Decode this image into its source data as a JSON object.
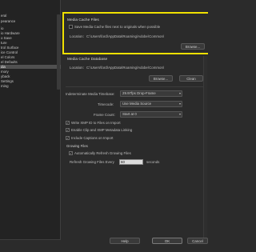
{
  "sidebar": {
    "items": [
      {
        "label": "eral"
      },
      {
        "label": "pearance"
      },
      {
        "label": "io"
      },
      {
        "label": "io Hardware"
      },
      {
        "label": "o Save"
      },
      {
        "label": "ture"
      },
      {
        "label": "trol Surface"
      },
      {
        "label": "ice Control"
      },
      {
        "label": "el Colors"
      },
      {
        "label": "el Defaults"
      },
      {
        "label": "dia"
      },
      {
        "label": "mory"
      },
      {
        "label": "yback"
      },
      {
        "label": "Settings"
      },
      {
        "label": "ming"
      }
    ]
  },
  "media_cache_files": {
    "header": "Media Cache Files",
    "save_next_label": "Save Media Cache files next to originals when possible",
    "save_next_checked": false,
    "location_label": "Location:",
    "location_path": "C:\\Users\\ford\\AppData\\Roaming\\Adobe\\Common\\",
    "browse_label": "Browse..."
  },
  "media_cache_database": {
    "header": "Media Cache Database",
    "location_label": "Location:",
    "location_path": "C:\\Users\\ford\\AppData\\Roaming\\Adobe\\Common\\",
    "browse_label": "Browse...",
    "clean_label": "Clean"
  },
  "settings": {
    "timebase_label": "Indeterminate Media Timebase:",
    "timebase_value": "29.97fps Drop-Frame",
    "timecode_label": "Timecode:",
    "timecode_value": "Use Media Source",
    "frame_count_label": "Frame Count:",
    "frame_count_value": "Start at 0",
    "write_xmp_label": "Write XMP ID to Files on Import",
    "write_xmp_checked": true,
    "enable_clip_label": "Enable Clip and XMP Metadata Linking",
    "enable_clip_checked": true,
    "include_captions_label": "Include Captions on Import",
    "include_captions_checked": true
  },
  "growing_files": {
    "header": "Growing Files",
    "auto_refresh_label": "Automatically Refresh Growing Files",
    "auto_refresh_checked": true,
    "refresh_every_label": "Refresh Growing Files Every",
    "refresh_value": "60",
    "seconds_label": "seconds"
  },
  "footer": {
    "help_label": "Help",
    "ok_label": "OK",
    "cancel_label": "Cancel"
  },
  "colors": {
    "highlight": "#f0e000",
    "background": "#2b2b2b",
    "selected_item": "#505050"
  }
}
